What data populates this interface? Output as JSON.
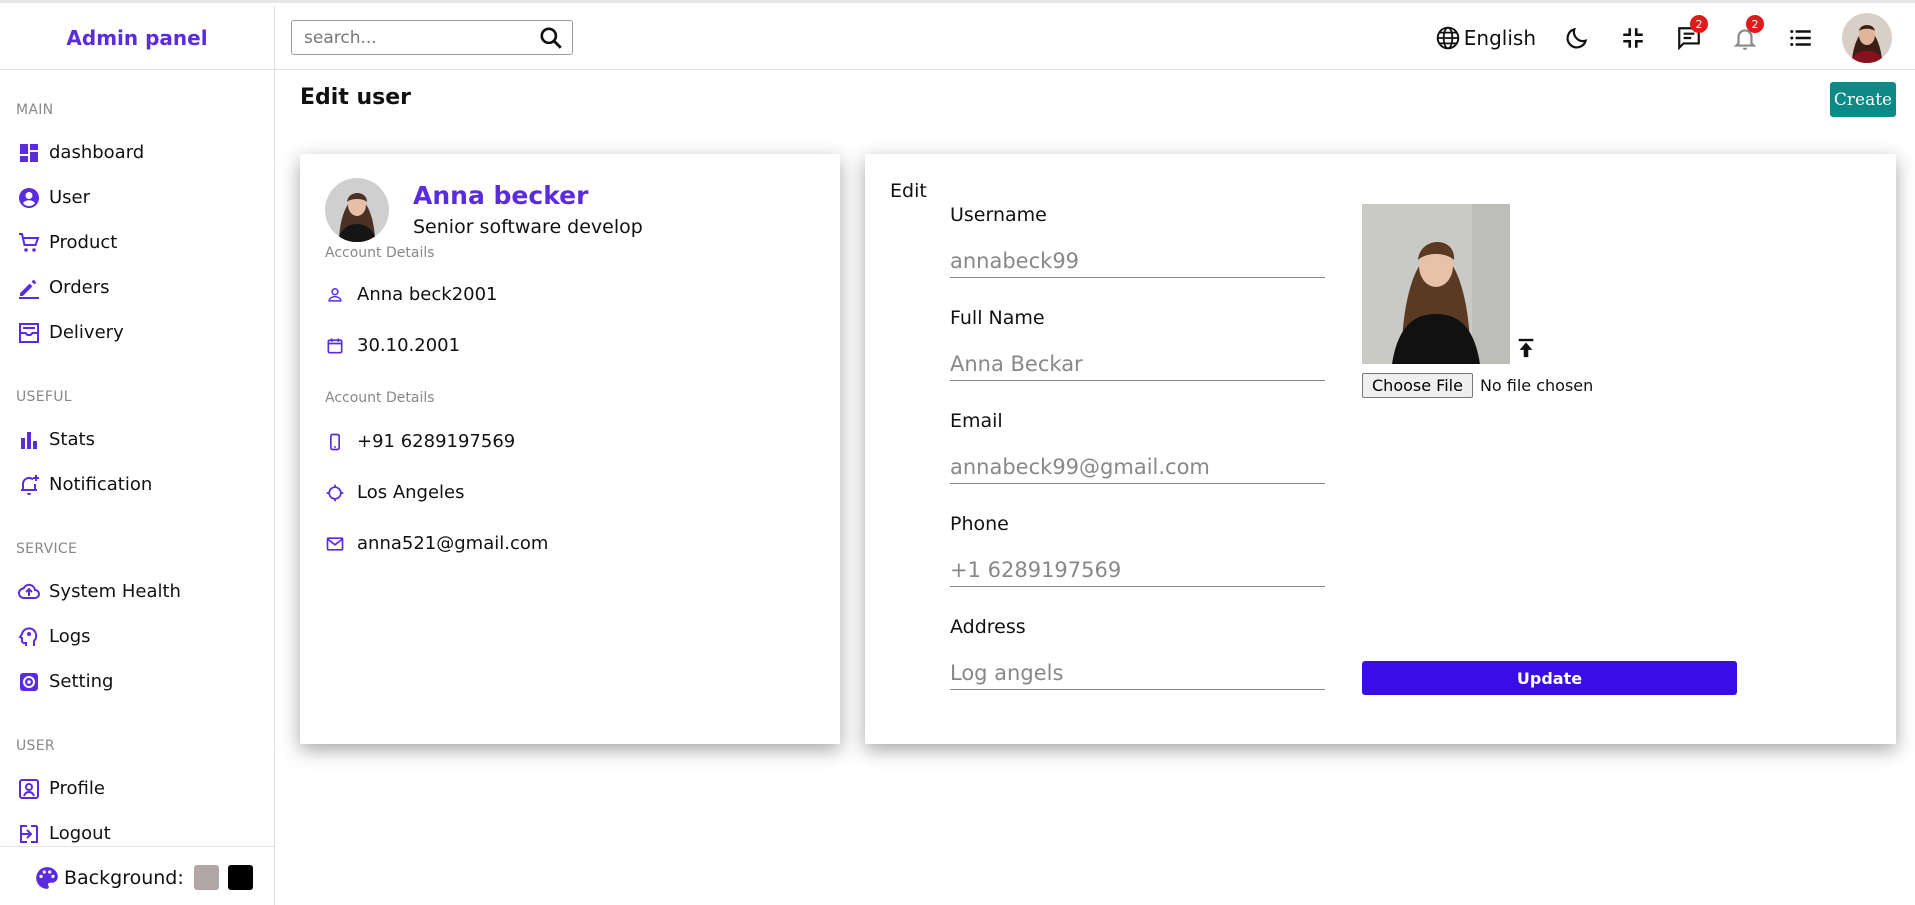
{
  "app": {
    "title": "Admin panel"
  },
  "sidebar": {
    "sections": [
      {
        "title": "MAIN",
        "items": [
          {
            "label": "dashboard",
            "icon": "dashboard-icon"
          },
          {
            "label": "User",
            "icon": "user-circle-icon"
          },
          {
            "label": "Product",
            "icon": "cart-icon"
          },
          {
            "label": "Orders",
            "icon": "pencil-icon"
          },
          {
            "label": "Delivery",
            "icon": "delivery-icon"
          }
        ]
      },
      {
        "title": "USEFUL",
        "items": [
          {
            "label": "Stats",
            "icon": "bar-chart-icon"
          },
          {
            "label": "Notification",
            "icon": "bell-plus-icon"
          }
        ]
      },
      {
        "title": "SERVICE",
        "items": [
          {
            "label": "System Health",
            "icon": "cloud-upload-icon"
          },
          {
            "label": "Logs",
            "icon": "psychology-icon"
          },
          {
            "label": "Setting",
            "icon": "gear-icon"
          }
        ]
      },
      {
        "title": "USER",
        "items": [
          {
            "label": "Profile",
            "icon": "profile-icon"
          },
          {
            "label": "Logout",
            "icon": "logout-icon"
          }
        ]
      }
    ],
    "background_label": "Background:",
    "swatches": [
      "#b3a6a7",
      "#000000"
    ]
  },
  "topbar": {
    "search_placeholder": "search...",
    "language": "English",
    "messages_badge": "2",
    "notifications_badge": "2"
  },
  "main": {
    "page_title": "Edit user",
    "create_label": "Create"
  },
  "profile": {
    "name": "Anna becker",
    "title": "Senior software develop",
    "account_details_label_1": "Account Details",
    "username": "Anna beck2001",
    "dob": "30.10.2001",
    "account_details_label_2": "Account Details",
    "phone": "+91 6289197569",
    "location": "Los Angeles",
    "email": "anna521@gmail.com"
  },
  "edit_form": {
    "heading": "Edit",
    "fields": [
      {
        "label": "Username",
        "placeholder": "annabeck99"
      },
      {
        "label": "Full Name",
        "placeholder": "Anna Beckar"
      },
      {
        "label": "Email",
        "placeholder": "annabeck99@gmail.com"
      },
      {
        "label": "Phone",
        "placeholder": "+1 6289197569"
      },
      {
        "label": "Address",
        "placeholder": "Log angels"
      }
    ],
    "file_button": "Choose File",
    "file_status": "No file chosen",
    "update_label": "Update"
  },
  "colors": {
    "accent": "#5b2be0",
    "create_button": "#0e8a86",
    "update_button": "#3a0ce8",
    "badge": "#e01b1b"
  }
}
